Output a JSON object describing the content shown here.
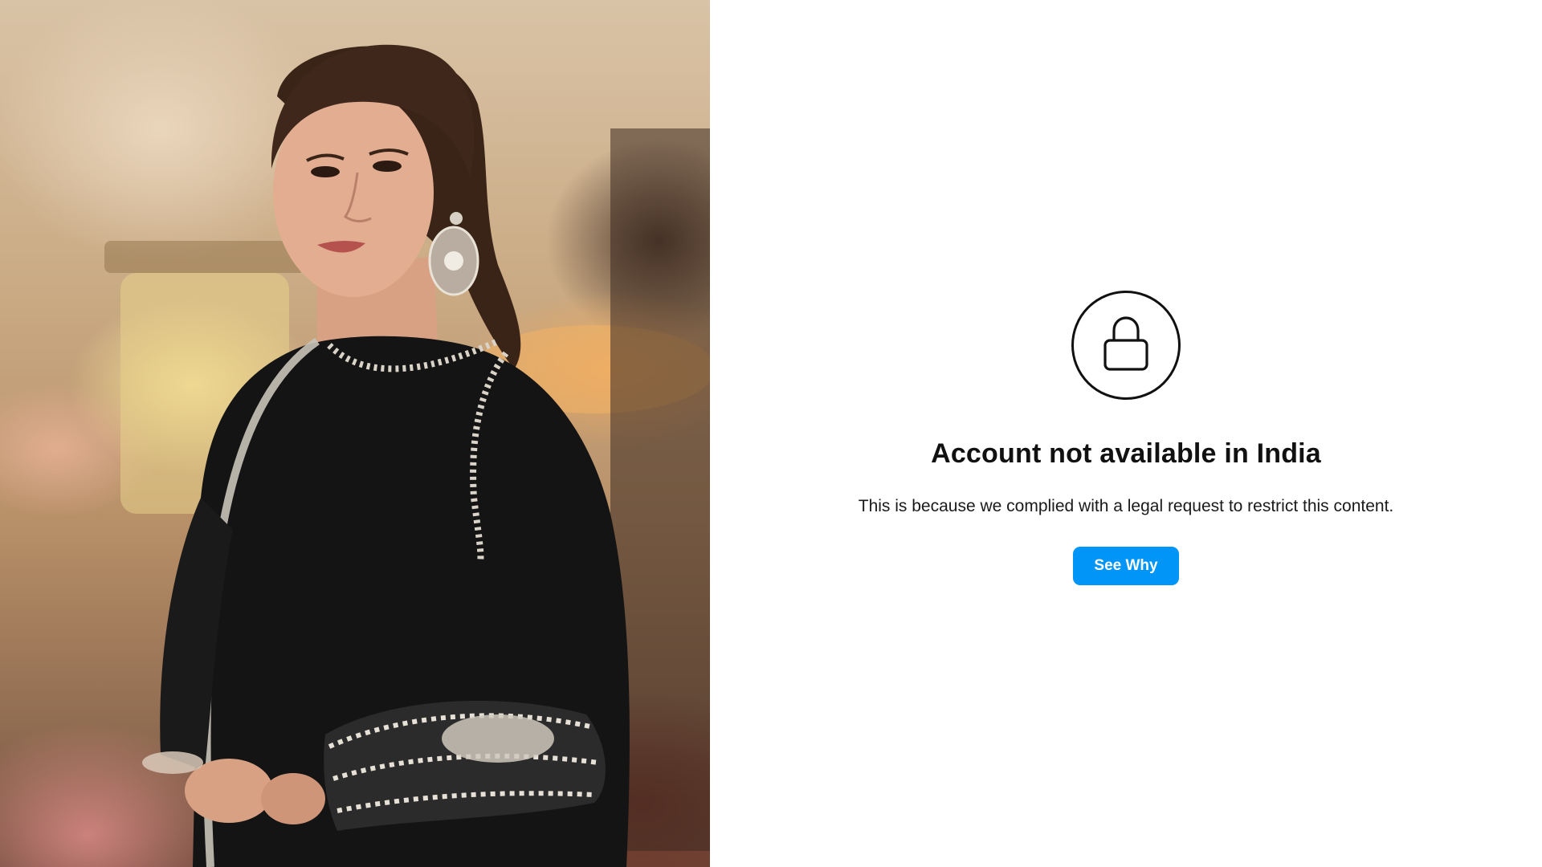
{
  "notice": {
    "title": "Account not available in India",
    "message": "This is because we complied with a legal request to restrict this content.",
    "button_label": "See Why"
  },
  "colors": {
    "button_background": "#0095f6",
    "button_text": "#ffffff",
    "title_text": "#111111",
    "page_background": "#ffffff"
  },
  "icons": {
    "lock": "lock-icon"
  }
}
